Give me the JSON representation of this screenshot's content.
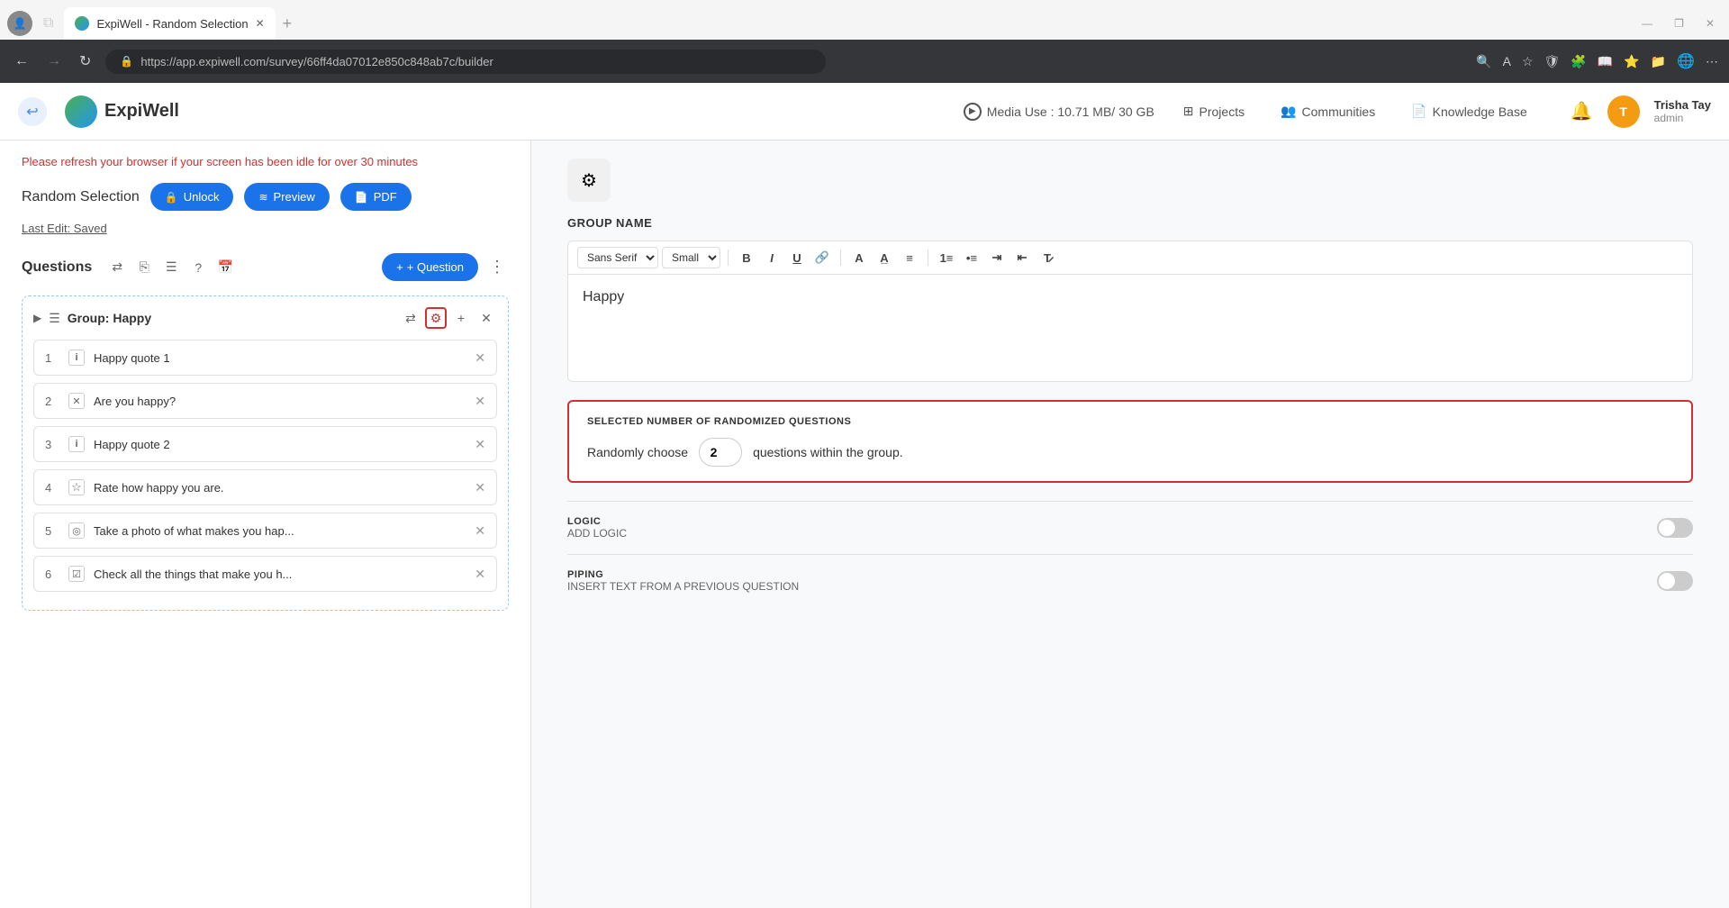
{
  "browser": {
    "tab_title": "ExpiWell - Random Selection",
    "url": "https://app.expiwell.com/survey/66ff4da07012e850c848ab7c/builder",
    "new_tab_label": "+"
  },
  "header": {
    "back_icon": "←",
    "logo_text": "ExpiWell",
    "media_label": "Media Use : 10.71 MB/ 30 GB",
    "projects_label": "Projects",
    "communities_label": "Communities",
    "knowledge_base_label": "Knowledge Base",
    "user_name": "Trisha Tay",
    "user_role": "admin",
    "user_initials": "T"
  },
  "left_panel": {
    "warning": "Please refresh your browser if your screen has been idle for over 30 minutes",
    "survey_title": "Random Selection",
    "unlock_btn": "Unlock",
    "preview_btn": "Preview",
    "pdf_btn": "PDF",
    "last_edit": "Last Edit: Saved",
    "questions_label": "Questions",
    "add_question_btn": "+ Question",
    "group_name": "Group: Happy",
    "questions": [
      {
        "num": "1",
        "type": "info",
        "type_icon": "i",
        "text": "Happy quote 1"
      },
      {
        "num": "2",
        "type": "checkbox",
        "type_icon": "✕",
        "text": "Are you happy?"
      },
      {
        "num": "3",
        "type": "info",
        "type_icon": "i",
        "text": "Happy quote 2"
      },
      {
        "num": "4",
        "type": "star",
        "type_icon": "☆",
        "text": "Rate how happy you are."
      },
      {
        "num": "5",
        "type": "camera",
        "type_icon": "◎",
        "text": "Take a photo of what makes you hap..."
      },
      {
        "num": "6",
        "type": "check",
        "type_icon": "☑",
        "text": "Check all the things that make you h..."
      }
    ]
  },
  "right_panel": {
    "group_name_label": "GROUP NAME",
    "font_family": "Sans Serif",
    "font_size": "Small",
    "editor_content": "Happy",
    "randomized_section_title": "SELECTED NUMBER OF RANDOMIZED QUESTIONS",
    "randomly_choose_label": "Randomly choose",
    "number_value": "2",
    "within_group_label": "questions within the group.",
    "logic_label": "LOGIC",
    "add_logic_label": "ADD LOGIC",
    "piping_label": "PIPING",
    "insert_text_label": "INSERT TEXT FROM A PREVIOUS QUESTION"
  }
}
